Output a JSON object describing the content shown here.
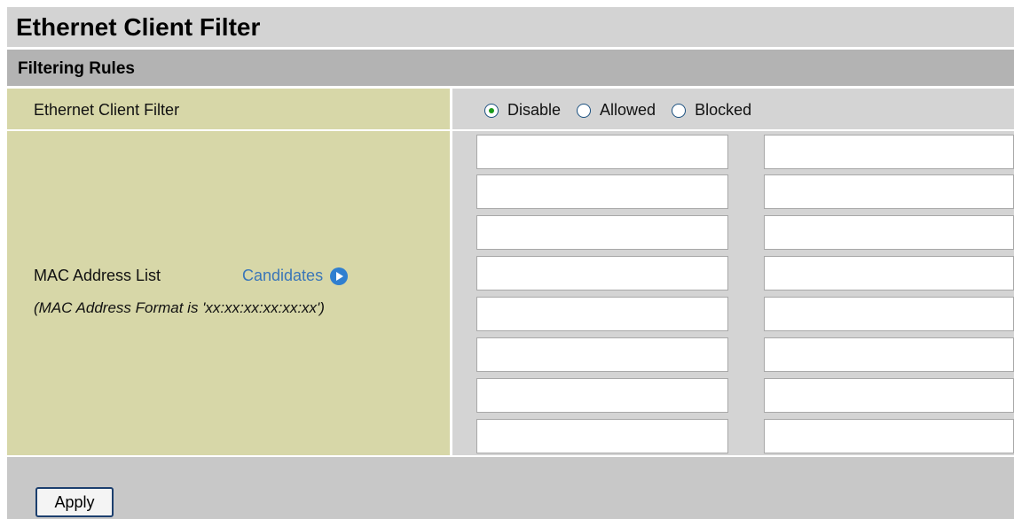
{
  "page": {
    "title": "Ethernet Client Filter"
  },
  "section": {
    "title": "Filtering Rules"
  },
  "filter": {
    "label": "Ethernet Client Filter",
    "options": [
      {
        "label": "Disable",
        "checked": true
      },
      {
        "label": "Allowed",
        "checked": false
      },
      {
        "label": "Blocked",
        "checked": false
      }
    ]
  },
  "mac_list": {
    "label": "MAC Address List",
    "candidates_label": "Candidates",
    "candidates_icon": "play-circle-icon",
    "format_hint": "(MAC Address Format is 'xx:xx:xx:xx:xx:xx')",
    "entries_left": [
      "",
      "",
      "",
      "",
      "",
      "",
      "",
      ""
    ],
    "entries_right": [
      "",
      "",
      "",
      "",
      "",
      "",
      "",
      ""
    ]
  },
  "actions": {
    "apply_label": "Apply"
  },
  "colors": {
    "title_bg": "#d3d3d3",
    "section_bg": "#b3b3b3",
    "label_bg": "#d7d7a8",
    "field_bg": "#d4d4d4",
    "link": "#3a76b8",
    "radio_dot": "#1a9a1a"
  }
}
